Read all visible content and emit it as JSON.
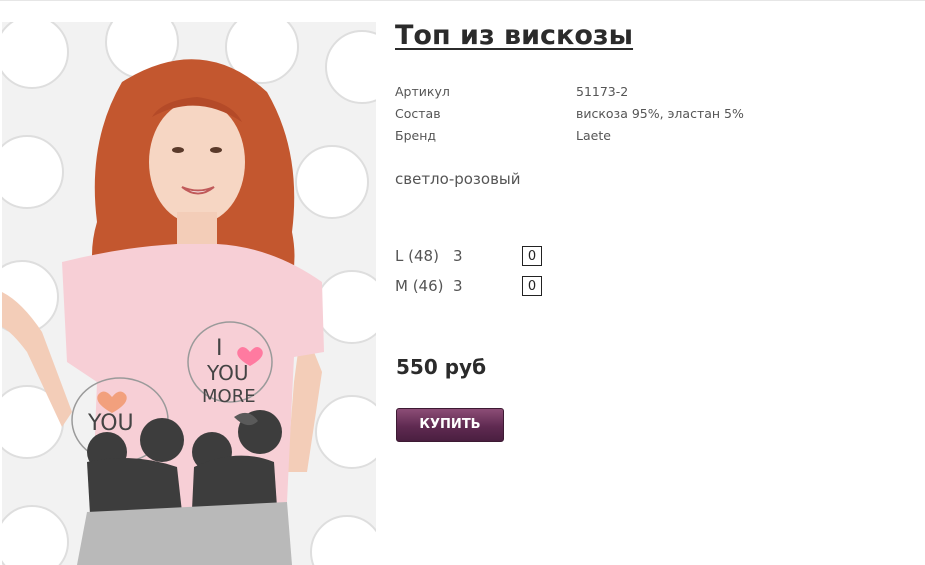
{
  "product": {
    "title": "Топ из вискозы",
    "attributes": [
      {
        "label": "Артикул",
        "value": "51173-2"
      },
      {
        "label": "Состав",
        "value": "вискоза 95%, эластан 5%"
      },
      {
        "label": "Бренд",
        "value": "Laete"
      }
    ],
    "color": "светло-розовый",
    "sizes": [
      {
        "label": "L (48)",
        "stock": "3",
        "quantity": "0"
      },
      {
        "label": "M (46)",
        "stock": "3",
        "quantity": "0"
      }
    ],
    "price": "550 руб",
    "buy_label": "КУПИТЬ",
    "photo": {
      "icon": "product-photo",
      "print_text": "I ♥ YOU MORE"
    }
  },
  "colors": {
    "buy_button": "#5f2a51",
    "title": "#2b2b2b",
    "label": "#555555"
  }
}
